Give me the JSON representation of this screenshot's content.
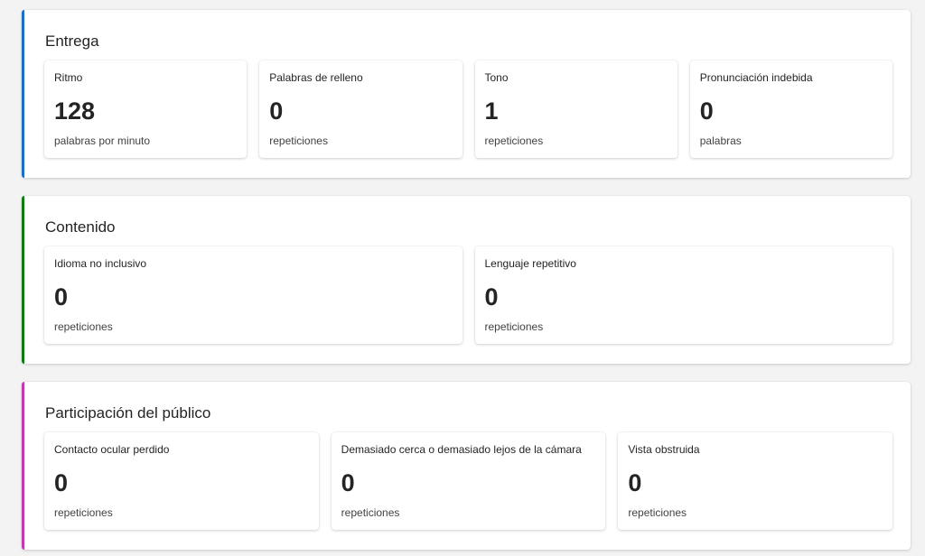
{
  "colors": {
    "delivery_accent": "#1b6ec2",
    "content_accent": "#107c10",
    "audience_accent": "#c239b3"
  },
  "sections": [
    {
      "title": "Entrega",
      "cards": [
        {
          "label": "Ritmo",
          "value": "128",
          "unit": "palabras por minuto"
        },
        {
          "label": "Palabras de relleno",
          "value": "0",
          "unit": "repeticiones"
        },
        {
          "label": "Tono",
          "value": "1",
          "unit": "repeticiones"
        },
        {
          "label": "Pronunciación indebida",
          "value": "0",
          "unit": "palabras"
        }
      ]
    },
    {
      "title": "Contenido",
      "cards": [
        {
          "label": "Idioma no inclusivo",
          "value": "0",
          "unit": "repeticiones"
        },
        {
          "label": "Lenguaje repetitivo",
          "value": "0",
          "unit": "repeticiones"
        }
      ]
    },
    {
      "title": "Participación del público",
      "cards": [
        {
          "label": "Contacto ocular perdido",
          "value": "0",
          "unit": "repeticiones"
        },
        {
          "label": "Demasiado cerca o demasiado lejos de la cámara",
          "value": "0",
          "unit": "repeticiones"
        },
        {
          "label": "Vista obstruida",
          "value": "0",
          "unit": "repeticiones"
        }
      ]
    }
  ]
}
